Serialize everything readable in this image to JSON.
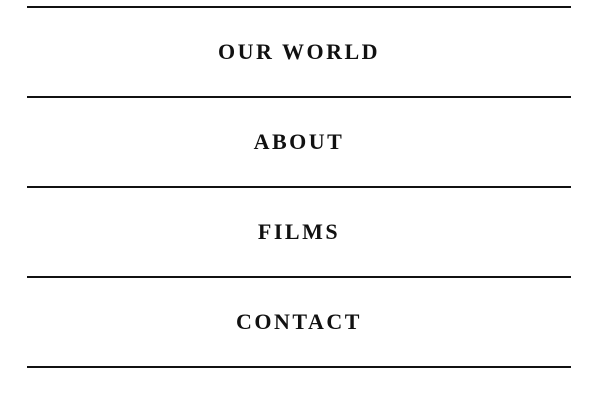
{
  "nav": {
    "items": [
      {
        "label": "OUR WORLD"
      },
      {
        "label": "ABOUT"
      },
      {
        "label": "FILMS"
      },
      {
        "label": "CONTACT"
      }
    ]
  }
}
